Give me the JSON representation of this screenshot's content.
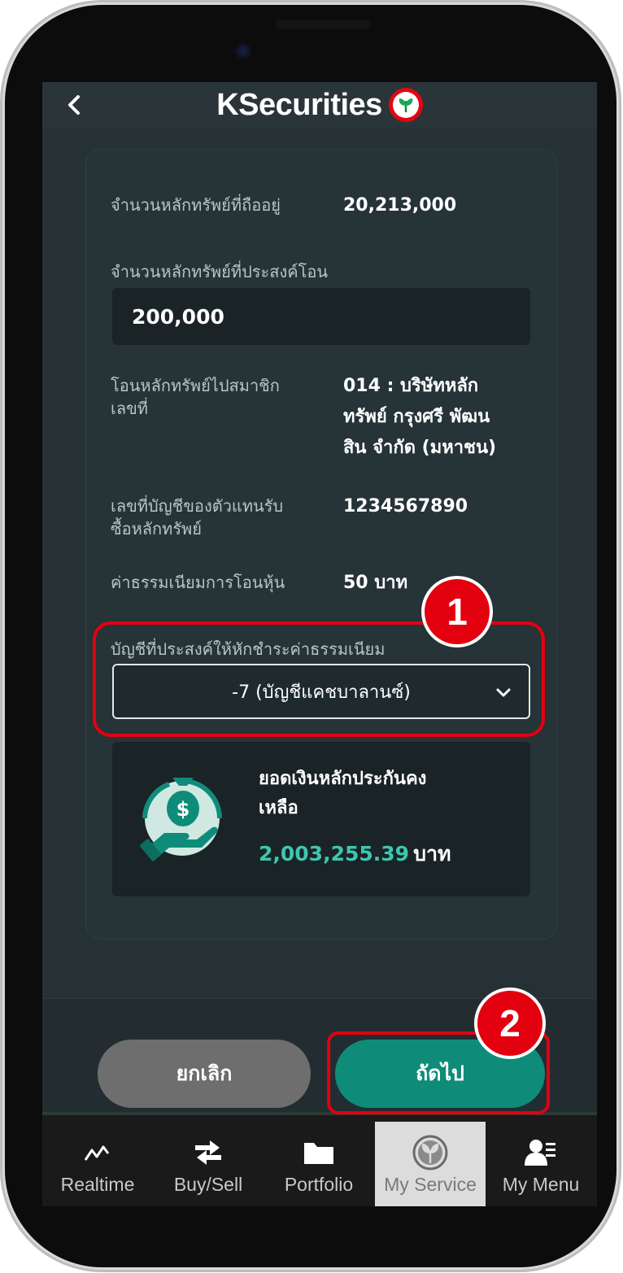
{
  "header": {
    "back_label": "<",
    "brand": "KSecurities"
  },
  "form": {
    "holding_label": "จำนวนหลักทรัพย์ที่ถืออยู่",
    "holding_value": "20,213,000",
    "transfer_qty_label": "จำนวนหลักทรัพย์ที่ประสงค์โอน",
    "transfer_qty_value": "200,000",
    "broker_label_line1": "โอนหลักทรัพย์ไปสมาชิก",
    "broker_label_line2": "เลขที่",
    "broker_value_line1": "014 : บริษัทหลัก",
    "broker_value_line2": "ทรัพย์ กรุงศรี พัฒน",
    "broker_value_line3": "สิน จำกัด (มหาชน)",
    "agent_account_label_line1": "เลขที่บัญชีของตัวแทนรับ",
    "agent_account_label_line2": "ซื้อหลักทรัพย์",
    "agent_account_value": "1234567890",
    "fee_label": "ค่าธรรมเนียมการโอนหุ้น",
    "fee_value": "50 บาท",
    "fee_account_label": "บัญชีที่ประสงค์ให้หักชำระค่าธรรมเนียม",
    "fee_account_selected": "-7 (บัญชีแคชบาลานซ์)"
  },
  "balance": {
    "title_line1": "ยอดเงินหลักประกันคง",
    "title_line2": "เหลือ",
    "amount": "2,003,255.39",
    "unit": "บาท"
  },
  "actions": {
    "cancel_label": "ยกเลิก",
    "next_label": "ถัดไป"
  },
  "annotations": {
    "step1": "1",
    "step2": "2"
  },
  "tabs": [
    {
      "label": "Realtime",
      "icon": "chart-line-icon",
      "active": false
    },
    {
      "label": "Buy/Sell",
      "icon": "swap-arrows-icon",
      "active": false
    },
    {
      "label": "Portfolio",
      "icon": "folder-icon",
      "active": false
    },
    {
      "label": "My Service",
      "icon": "kbank-leaf-icon",
      "active": true
    },
    {
      "label": "My Menu",
      "icon": "user-menu-icon",
      "active": false
    }
  ],
  "colors": {
    "accent_green": "#0f8c79",
    "amount_green": "#3ec6ae",
    "highlight_red": "#e3000f"
  }
}
